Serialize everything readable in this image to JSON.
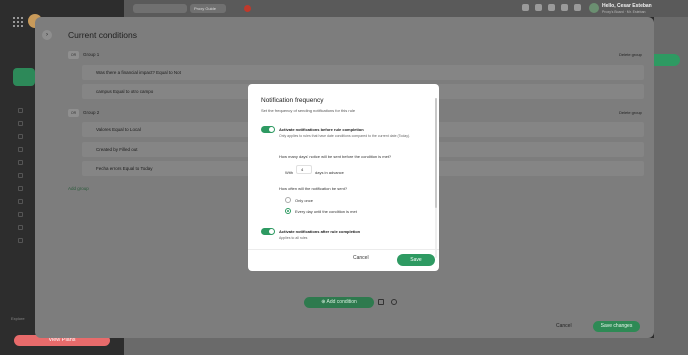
{
  "sidebar": {
    "view_button": "View Plans",
    "explore_label": "Explore"
  },
  "topbar": {
    "app_chip": "Proxy Guide",
    "user_name": "Hello, Cesar Esteban",
    "user_sub": "Proxy's Board · Mr. Esteban"
  },
  "background": {
    "add_rule": "+ New rule"
  },
  "panel": {
    "title": "Current conditions",
    "groups": [
      {
        "or_badge": "OR",
        "label": "Group 1",
        "delete": "Delete group",
        "conditions": [
          "Was there a financial impact? Equal to Not",
          "campus Equal to otro campo"
        ]
      },
      {
        "or_badge": "OR",
        "label": "Group 2",
        "delete": "Delete group",
        "conditions": [
          "Valores Equal to Local",
          "Created by Filled out",
          "Fecha errors Equal to Today"
        ]
      }
    ],
    "add_group": "Add group",
    "add_condition": "Add condition",
    "cancel": "Cancel",
    "save_changes": "Save changes"
  },
  "dialog": {
    "title": "Notification frequency",
    "subtitle": "Set the frequency of sending notifications for this rule",
    "before": {
      "title": "Activate notifications before rule completion",
      "note": "Only applies to rules that have date conditions compared to the current date (Today).",
      "days_question": "How many days' notice will be sent before the condition is met?",
      "with_label": "With",
      "days_value": "4",
      "days_suffix": "days in advance",
      "how_often": "How often will the notification be sent?",
      "options": [
        "Only once",
        "Every day until the condition is met"
      ],
      "selected": 1
    },
    "after": {
      "title": "Activate notifications after rule completion",
      "note": "Applies to all rules"
    },
    "cancel": "Cancel",
    "save": "Save"
  },
  "colors": {
    "accent": "#2e9a62",
    "danger": "#e86b6b"
  }
}
